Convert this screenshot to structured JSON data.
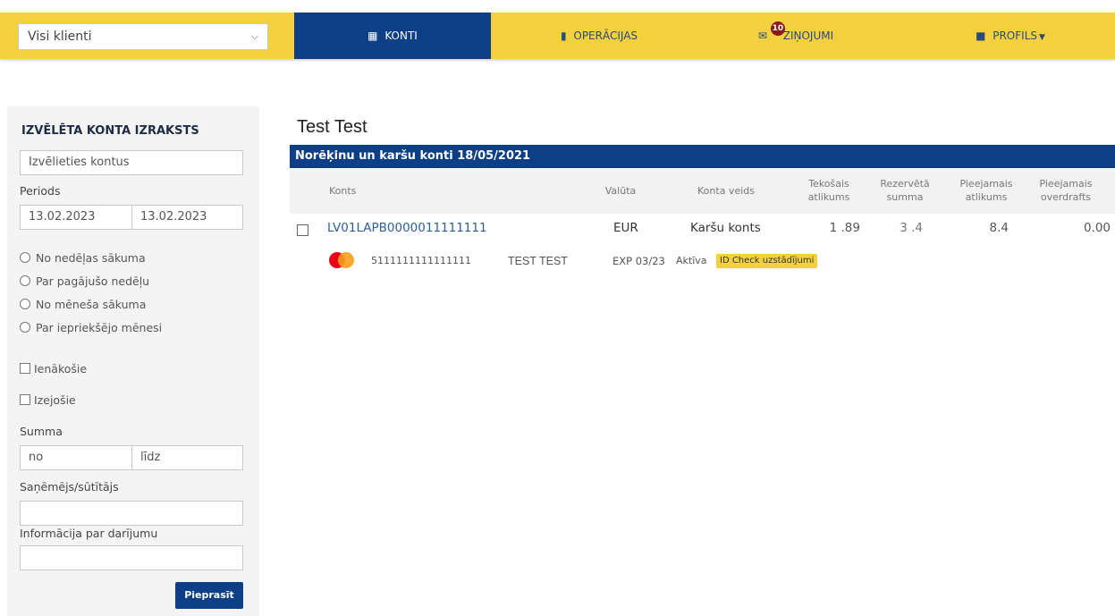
{
  "topbar": {
    "client_select": {
      "value": "Visi klienti"
    },
    "nav": [
      {
        "label": "KONTI",
        "icon": "grid-icon",
        "active": true
      },
      {
        "label": "OPERĀCIJAS",
        "icon": "document-icon"
      },
      {
        "label": "ZIŅOJUMI",
        "icon": "envelope-icon",
        "badge": "10"
      },
      {
        "label": "PROFILS",
        "icon": "briefcase-icon"
      }
    ]
  },
  "sidebar": {
    "title": "IZVĒLĒTA KONTA IZRAKSTS",
    "account_select_placeholder": "Izvēlieties kontus",
    "period_label": "Periods",
    "date_from": "13.02.2023",
    "date_to": "13.02.2023",
    "period_options": [
      "No nedēļas sākuma",
      "Par pagājušo nedēļu",
      "No mēneša sākuma",
      "Par iepriekšējo mēnesi"
    ],
    "checkbox_incoming": "Ienākošie",
    "checkbox_outgoing": "Izejošie",
    "summa_label": "Summa",
    "summa_from_placeholder": "no",
    "summa_to_placeholder": "līdz",
    "recipient_label": "Saņēmējs/sūtītājs",
    "info_label": "Informācija par darījumu",
    "submit_label": "Pieprasīt"
  },
  "main": {
    "title": "Test Test",
    "section_title": "Norēķinu un karšu konti 18/05/2021",
    "columns": [
      {
        "line1": "Konts",
        "line2": ""
      },
      {
        "line1": "Valūta",
        "line2": ""
      },
      {
        "line1": "Konta veids",
        "line2": ""
      },
      {
        "line1": "Tekošais",
        "line2": "atlikums"
      },
      {
        "line1": "Rezervētā",
        "line2": "summa"
      },
      {
        "line1": "Pieejamais",
        "line2": "atlikums"
      },
      {
        "line1": "Pieejamais",
        "line2": "overdrafts"
      }
    ],
    "account_row": {
      "account": "LV01LAPB0000011111111",
      "currency": "EUR",
      "type": "Karšu konts",
      "current_balance": "1   .89",
      "reserved": "3  .4",
      "available_balance": "8.4",
      "available_overdraft": "0.00"
    },
    "card_row": {
      "card_number": "5111111111111111",
      "holder": "TEST TEST",
      "expiry": "EXP 03/23",
      "status": "Aktīva",
      "id_check_label": "ID Check uzstādījumi"
    }
  }
}
